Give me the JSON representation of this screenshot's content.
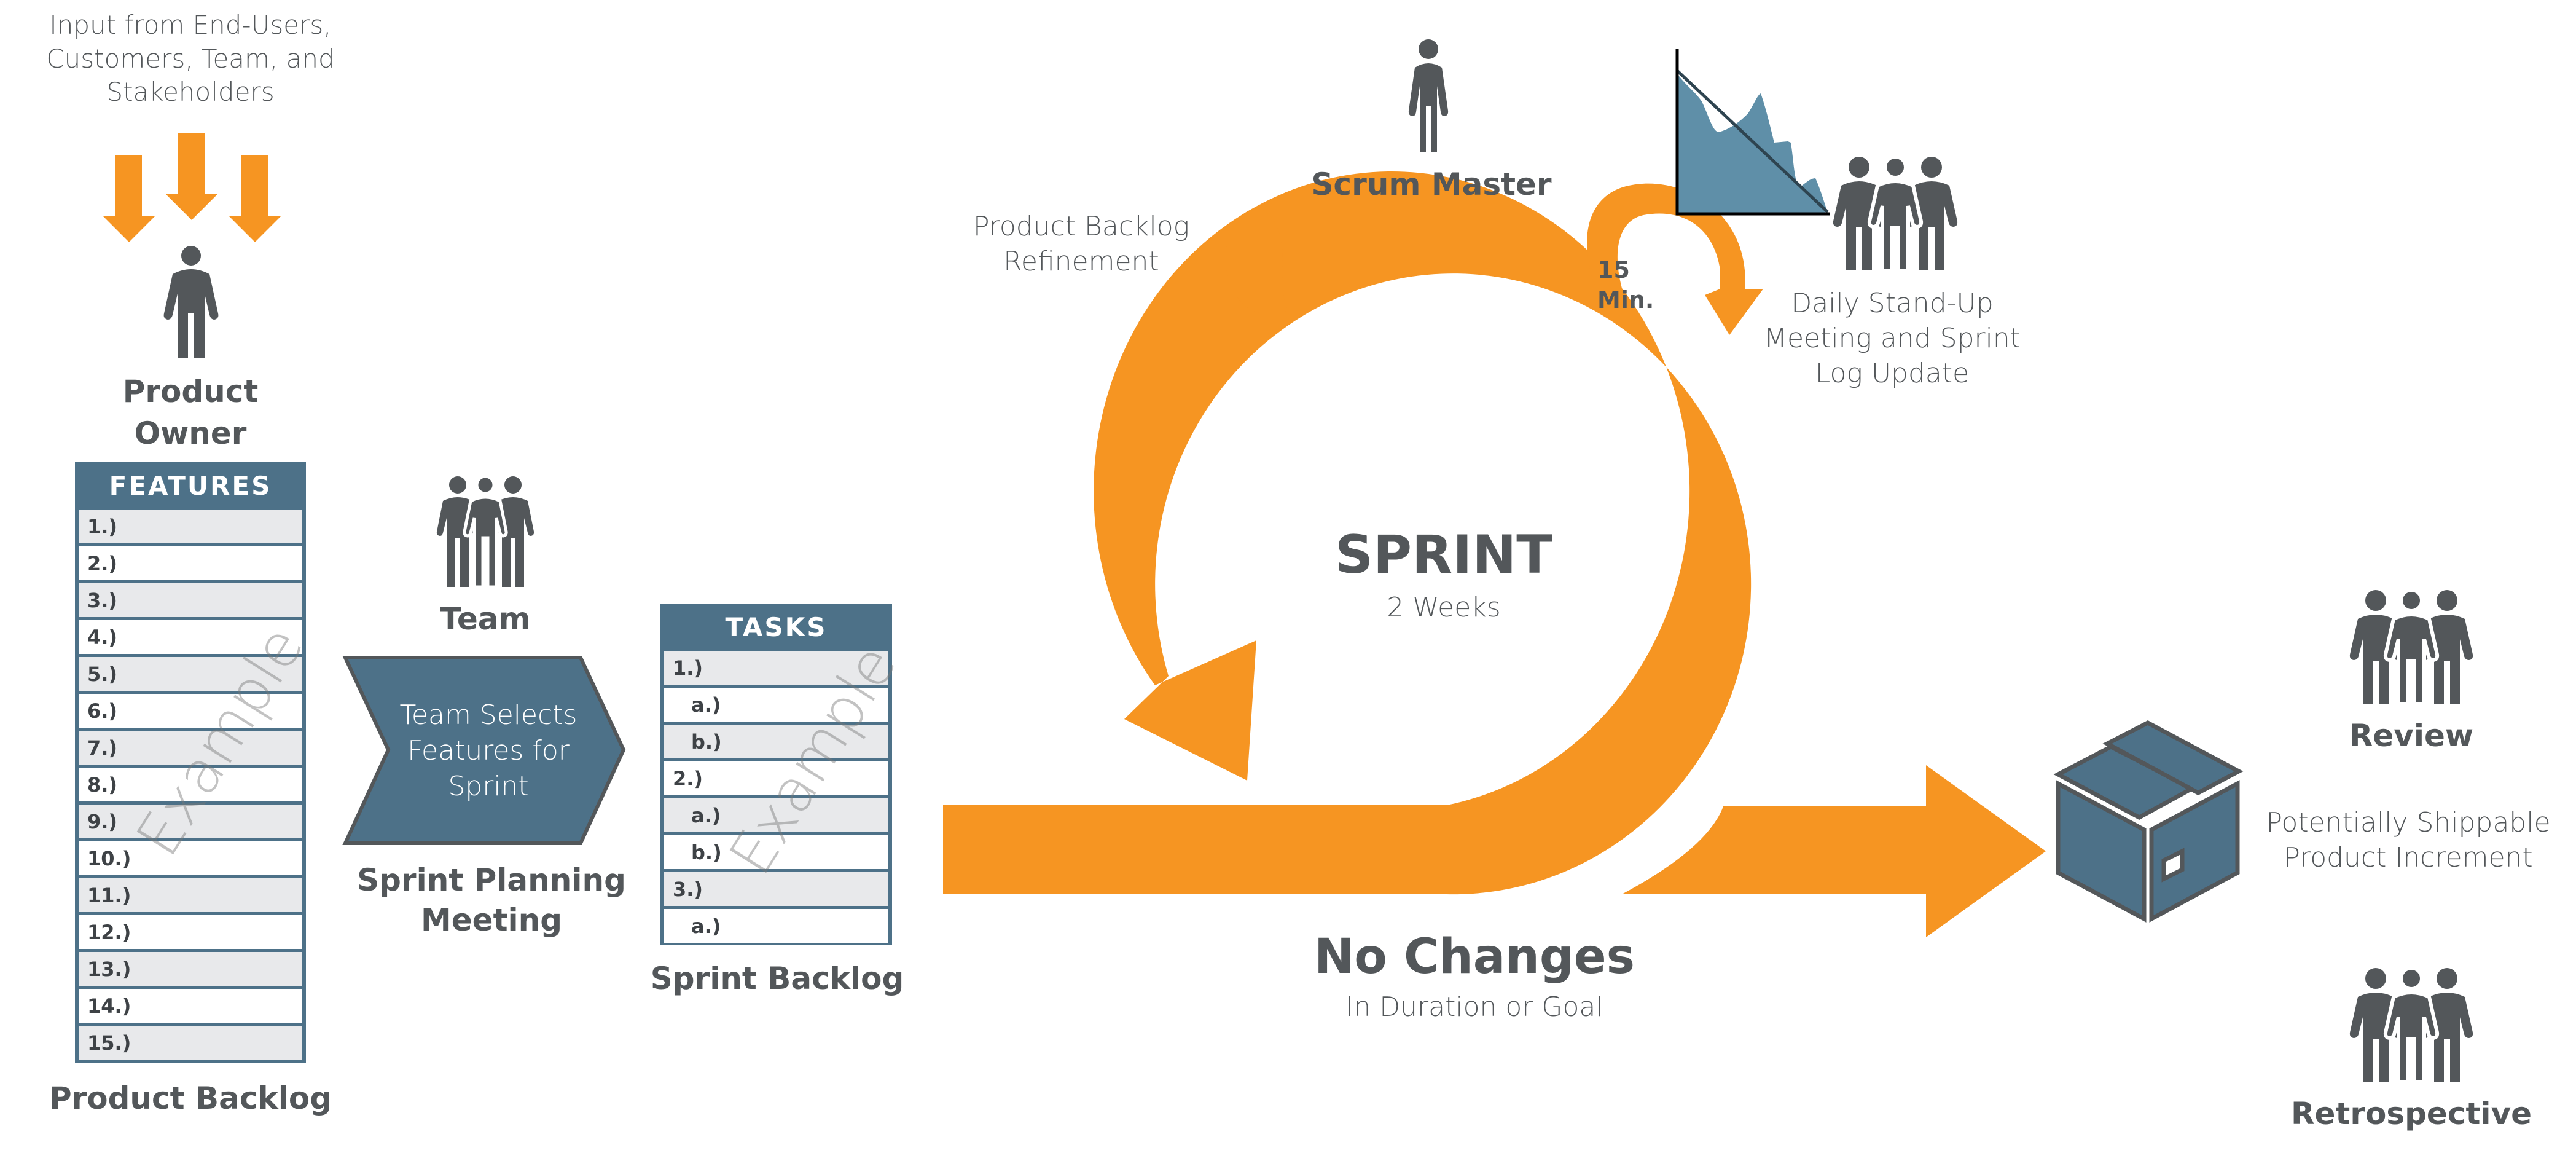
{
  "input": {
    "text": "Input from End-Users, Customers, Team, and Stakeholders",
    "lines": [
      "Input from End-Users,",
      "Customers, Team, and",
      "Stakeholders"
    ]
  },
  "product_owner": {
    "lines": [
      "Product",
      "Owner"
    ]
  },
  "product_backlog": {
    "header": "FEATURES",
    "rows": [
      "1.)",
      "2.)",
      "3.)",
      "4.)",
      "5.)",
      "6.)",
      "7.)",
      "8.)",
      "9.)",
      "10.)",
      "11.)",
      "12.)",
      "13.)",
      "14.)",
      "15.)"
    ],
    "watermark": "Example",
    "caption": "Product Backlog"
  },
  "team": {
    "label": "Team"
  },
  "sprint_planning": {
    "chevron_lines": [
      "Team Selects",
      "Features for",
      "Sprint"
    ],
    "caption_lines": [
      "Sprint Planning",
      "Meeting"
    ]
  },
  "sprint_backlog": {
    "header": "TASKS",
    "rows": [
      {
        "label": "1.)",
        "sub": false
      },
      {
        "label": "a.)",
        "sub": true
      },
      {
        "label": "b.)",
        "sub": true
      },
      {
        "label": "2.)",
        "sub": false
      },
      {
        "label": "a.)",
        "sub": true
      },
      {
        "label": "b.)",
        "sub": true
      },
      {
        "label": "3.)",
        "sub": false
      },
      {
        "label": "a.)",
        "sub": true
      }
    ],
    "watermark": "Example",
    "caption": "Sprint Backlog"
  },
  "refinement": {
    "lines": [
      "Product Backlog",
      "Refinement"
    ]
  },
  "scrum_master": {
    "label": "Scrum Master"
  },
  "daily": {
    "timebox": "15 Min.",
    "lines": [
      "Daily Stand-Up",
      "Meeting and Sprint",
      "Log Update"
    ]
  },
  "sprint": {
    "title": "SPRINT",
    "duration": "2 Weeks"
  },
  "no_changes": {
    "title": "No Changes",
    "subtitle": "In Duration or Goal"
  },
  "increment": {
    "lines": [
      "Potentially Shippable",
      "Product Increment"
    ]
  },
  "review": {
    "label": "Review"
  },
  "retrospective": {
    "label": "Retrospective"
  },
  "colors": {
    "orange": "#f69522",
    "slate": "#4d7188",
    "text": "#53575a",
    "chart": "#5f8fa8"
  }
}
